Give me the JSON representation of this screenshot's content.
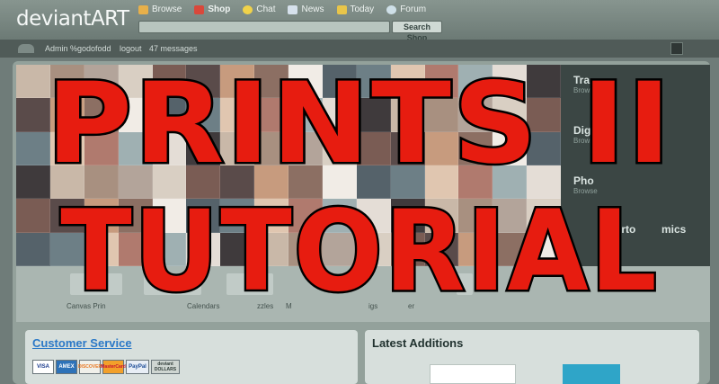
{
  "header": {
    "logo": "deviantART",
    "nav": [
      {
        "label": "Browse",
        "icon": "browse-icon",
        "color": "#e8b04a"
      },
      {
        "label": "Shop",
        "icon": "shop-icon",
        "color": "#d9483b",
        "active": true
      },
      {
        "label": "Chat",
        "icon": "chat-icon",
        "color": "#f0d24a"
      },
      {
        "label": "News",
        "icon": "news-icon",
        "color": "#d6e1ec"
      },
      {
        "label": "Today",
        "icon": "today-icon",
        "color": "#e8c54a"
      },
      {
        "label": "Forum",
        "icon": "forum-icon",
        "color": "#cfe0e8"
      }
    ],
    "search_button": "Search Shop"
  },
  "userbar": {
    "role": "Admin",
    "user": "%godofodd",
    "logout": "logout",
    "messages": "47 messages"
  },
  "categories": [
    {
      "title": "Tra",
      "sub": "Browse"
    },
    {
      "title": "Digit",
      "sub": "Browse"
    },
    {
      "title": "Pho",
      "sub": "Browse"
    },
    {
      "title": "Carto",
      "sub": ""
    },
    {
      "title": "mics",
      "sub": ""
    }
  ],
  "products": [
    "Canvas Prin",
    "Calendars",
    "zzles",
    "M",
    "igs",
    "er"
  ],
  "panels": {
    "customer_service": "Customer Service",
    "latest_additions": "Latest Additions"
  },
  "payments": [
    "VISA",
    "AMEX",
    "DISCOVER",
    "MasterCard",
    "PayPal",
    "deviant DOLLARS"
  ],
  "overlay": {
    "line1": "PRINTS II",
    "line2": "TUTORIAL"
  },
  "colors": {
    "accent": "#e71c10",
    "link": "#2a78c7"
  }
}
